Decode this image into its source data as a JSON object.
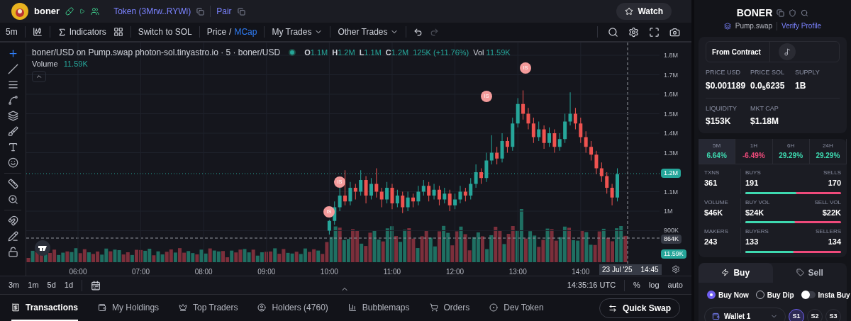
{
  "header": {
    "token_name": "boner",
    "token_link": "Token (3Mrw..RYWi)",
    "pair_link": "Pair",
    "watch_button": "Watch"
  },
  "toolbar": {
    "interval": "5m",
    "indicators": "Indicators",
    "switch": "Switch to SOL",
    "price": "Price",
    "separator": "/",
    "mcap": "MCap",
    "my_trades": "My Trades",
    "other_trades": "Other Trades"
  },
  "chart": {
    "legend_title": "boner/USD on Pump.swap photon-sol.tinyastro.io · 5 · boner/USD",
    "ohlc": [
      {
        "key": "O",
        "value": "1.1M"
      },
      {
        "key": "H",
        "value": "1.2M"
      },
      {
        "key": "L",
        "value": "1.1M"
      },
      {
        "key": "C",
        "value": "1.2M"
      }
    ],
    "change": "125K (+11.76%)",
    "vol_key": "Vol",
    "vol_value": "11.59K",
    "volume_label": "Volume",
    "volume_value": "11.59K",
    "chart_data": {
      "type": "candlestick",
      "grid": true,
      "x": [
        600,
        605,
        610,
        615,
        620,
        625,
        630,
        635,
        640,
        645,
        650,
        655,
        660,
        665,
        670,
        675,
        680,
        685,
        690,
        695,
        700,
        705,
        710,
        715,
        720,
        725,
        730,
        735,
        740,
        745,
        750,
        755,
        760,
        765,
        770,
        775,
        780,
        785,
        790,
        795,
        800,
        805,
        810,
        815,
        820,
        825,
        830,
        835,
        840,
        845,
        850,
        855,
        860,
        865,
        870,
        875
      ],
      "ohlc": [
        [
          900000,
          955000,
          880000,
          950000
        ],
        [
          950000,
          1050000,
          930000,
          1020000
        ],
        [
          1020000,
          1120000,
          1000000,
          1080000
        ],
        [
          1080000,
          1210000,
          1030000,
          1050000
        ],
        [
          1050000,
          1150000,
          1030000,
          1120000
        ],
        [
          1120000,
          1140000,
          1060000,
          1100000
        ],
        [
          1100000,
          1210000,
          1080000,
          1160000
        ],
        [
          1160000,
          1180000,
          1040000,
          1080000
        ],
        [
          1080000,
          1170000,
          1060000,
          1140000
        ],
        [
          1140000,
          1220000,
          1070000,
          1100000
        ],
        [
          1100000,
          1120000,
          1020000,
          1060000
        ],
        [
          1060000,
          1150000,
          1040000,
          1120000
        ],
        [
          1120000,
          1140000,
          1010000,
          1040000
        ],
        [
          1040000,
          1110000,
          1020000,
          1080000
        ],
        [
          1080000,
          1100000,
          990000,
          1020000
        ],
        [
          1020000,
          1100000,
          1000000,
          1070000
        ],
        [
          1070000,
          1090000,
          1020000,
          1050000
        ],
        [
          1050000,
          1130000,
          1030000,
          1100000
        ],
        [
          1100000,
          1160000,
          1080000,
          1130000
        ],
        [
          1130000,
          1150000,
          1050000,
          1080000
        ],
        [
          1080000,
          1140000,
          1060000,
          1110000
        ],
        [
          1110000,
          1130000,
          1030000,
          1060000
        ],
        [
          1060000,
          1120000,
          1040000,
          1090000
        ],
        [
          1090000,
          1110000,
          1000000,
          1030000
        ],
        [
          1030000,
          1090000,
          1010000,
          1060000
        ],
        [
          1060000,
          1130000,
          1040000,
          1100000
        ],
        [
          1100000,
          1120000,
          1050000,
          1080000
        ],
        [
          1080000,
          1170000,
          1060000,
          1140000
        ],
        [
          1140000,
          1240000,
          1120000,
          1200000
        ],
        [
          1200000,
          1220000,
          1140000,
          1170000
        ],
        [
          1170000,
          1300000,
          1150000,
          1260000
        ],
        [
          1260000,
          1390000,
          1240000,
          1300000
        ],
        [
          1300000,
          1330000,
          1240000,
          1270000
        ],
        [
          1270000,
          1400000,
          1250000,
          1360000
        ],
        [
          1360000,
          1380000,
          1300000,
          1330000
        ],
        [
          1330000,
          1480000,
          1310000,
          1450000
        ],
        [
          1450000,
          1580000,
          1430000,
          1550000
        ],
        [
          1550000,
          1620000,
          1470000,
          1500000
        ],
        [
          1500000,
          1530000,
          1420000,
          1450000
        ],
        [
          1450000,
          1480000,
          1350000,
          1380000
        ],
        [
          1380000,
          1460000,
          1360000,
          1420000
        ],
        [
          1420000,
          1440000,
          1320000,
          1350000
        ],
        [
          1350000,
          1430000,
          1330000,
          1400000
        ],
        [
          1400000,
          1420000,
          1300000,
          1330000
        ],
        [
          1330000,
          1400000,
          1310000,
          1370000
        ],
        [
          1370000,
          1500000,
          1350000,
          1460000
        ],
        [
          1460000,
          1610000,
          1440000,
          1500000
        ],
        [
          1500000,
          1530000,
          1420000,
          1450000
        ],
        [
          1450000,
          1480000,
          1350000,
          1380000
        ],
        [
          1380000,
          1410000,
          1300000,
          1330000
        ],
        [
          1330000,
          1360000,
          1260000,
          1290000
        ],
        [
          1290000,
          1310000,
          1190000,
          1220000
        ],
        [
          1220000,
          1250000,
          1150000,
          1180000
        ],
        [
          1180000,
          1200000,
          1090000,
          1120000
        ],
        [
          1120000,
          1140000,
          1030000,
          1070000
        ],
        [
          1070000,
          1220000,
          1050000,
          1190000
        ]
      ],
      "xlim": [
        310.6,
        915.3
      ],
      "ylim": [
        730900,
        1865500
      ],
      "xticks": [
        {
          "value": 360,
          "label": "06:00"
        },
        {
          "value": 420,
          "label": "07:00"
        },
        {
          "value": 480,
          "label": "08:00"
        },
        {
          "value": 540,
          "label": "09:00"
        },
        {
          "value": 600,
          "label": "10:00"
        },
        {
          "value": 660,
          "label": "11:00"
        },
        {
          "value": 720,
          "label": "12:00"
        },
        {
          "value": 780,
          "label": "13:00"
        },
        {
          "value": 840,
          "label": "14:00"
        }
      ],
      "yticks": [
        {
          "value": 1800000,
          "label": "1.8M"
        },
        {
          "value": 1700000,
          "label": "1.7M"
        },
        {
          "value": 1600000,
          "label": "1.6M"
        },
        {
          "value": 1500000,
          "label": "1.5M"
        },
        {
          "value": 1400000,
          "label": "1.4M"
        },
        {
          "value": 1300000,
          "label": "1.3M"
        },
        {
          "value": 1100000,
          "label": "1.1M"
        },
        {
          "value": 1000000,
          "label": "1M"
        },
        {
          "value": 900000,
          "label": "900K"
        }
      ]
    },
    "price_badges": [
      {
        "label": "1.2M",
        "kind": "last"
      },
      {
        "label": "864K",
        "kind": "crosshair"
      },
      {
        "label": "11.59K",
        "kind": "volume"
      }
    ],
    "crosshair_date": "23 Jul '25",
    "crosshair_time": "14:45",
    "markers": [
      "IS",
      "IS",
      "IS",
      "IS"
    ]
  },
  "range_bar": {
    "ranges": [
      "3m",
      "1m",
      "5d",
      "1d"
    ],
    "clock": "14:35:16 UTC",
    "options": [
      "%",
      "log",
      "auto"
    ]
  },
  "bottom_tabs": [
    {
      "label": "Transactions",
      "selected": true
    },
    {
      "label": "My Holdings",
      "selected": false
    },
    {
      "label": "Top Traders",
      "selected": false
    },
    {
      "label": "Holders (4760)",
      "selected": false
    },
    {
      "label": "Bubblemaps",
      "selected": false
    },
    {
      "label": "Orders",
      "selected": false
    },
    {
      "label": "Dev Token",
      "selected": false
    }
  ],
  "quick_swap": "Quick Swap",
  "token": {
    "symbol": "BONER",
    "dex": "Pump.swap",
    "verify": "Verify Profile",
    "source": "From Contract",
    "stats": [
      {
        "label": "PRICE USD",
        "value": "$0.001189"
      },
      {
        "label": "PRICE SOL",
        "value": "0.0$_{5}$6235"
      },
      {
        "label": "SUPPLY",
        "value": "1B"
      },
      {
        "label": "LIQUIDITY",
        "value": "$153K"
      },
      {
        "label": "MKT CAP",
        "value": "$1.18M"
      }
    ]
  },
  "timeframes": [
    {
      "label": "5M",
      "change": "6.64%",
      "color": "#3ed9b0",
      "selected": true
    },
    {
      "label": "1H",
      "change": "-6.49%",
      "color": "#ef4a7b",
      "selected": false
    },
    {
      "label": "6H",
      "change": "29.29%",
      "color": "#3ed9b0",
      "selected": false
    },
    {
      "label": "24H",
      "change": "29.29%",
      "color": "#3ed9b0",
      "selected": false
    }
  ],
  "activity": [
    {
      "label": "TXNS",
      "value": "361",
      "left_label": "BUYS",
      "left_value": "191",
      "right_label": "SELLS",
      "right_value": "170",
      "level": 0.53
    },
    {
      "label": "VOLUME",
      "value": "$46K",
      "left_label": "BUY VOL",
      "left_value": "$24K",
      "right_label": "SELL VOL",
      "right_value": "$22K",
      "level": 0.52
    },
    {
      "label": "MAKERS",
      "value": "243",
      "left_label": "BUYERS",
      "left_value": "133",
      "right_label": "SELLERS",
      "right_value": "134",
      "level": 0.5
    }
  ],
  "trade": {
    "tabs": [
      {
        "label": "Buy",
        "selected": true
      },
      {
        "label": "Sell",
        "selected": false
      }
    ],
    "modes": [
      {
        "label": "Buy Now",
        "selected": true
      },
      {
        "label": "Buy Dip",
        "selected": false
      }
    ],
    "insta_buy": {
      "label": "Insta Buy",
      "on": false
    },
    "wallet": "Wallet 1",
    "slots": [
      {
        "label": "S1",
        "selected": true
      },
      {
        "label": "S2",
        "selected": false
      },
      {
        "label": "S3",
        "selected": false
      }
    ]
  }
}
